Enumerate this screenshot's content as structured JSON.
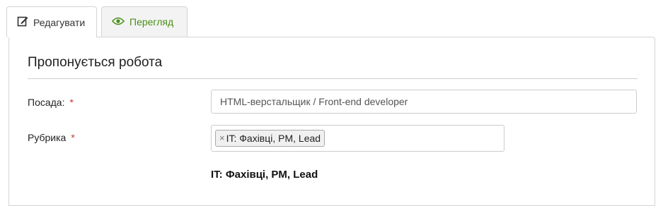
{
  "tabs": {
    "edit_label": "Редагувати",
    "view_label": "Перегляд"
  },
  "section": {
    "title": "Пропонується робота"
  },
  "fields": {
    "position": {
      "label": "Посада:",
      "required_mark": "*",
      "value": "HTML-верстальщик / Front-end developer"
    },
    "category": {
      "label": "Рубрика",
      "required_mark": "*",
      "remove_glyph": "×",
      "chip": "IT: Фахівці, PM, Lead",
      "selected_display": "IT: Фахівці, PM, Lead"
    }
  },
  "colors": {
    "accent_green": "#4b8f1a",
    "required_red": "#c0392b",
    "border": "#d4d4d4"
  }
}
